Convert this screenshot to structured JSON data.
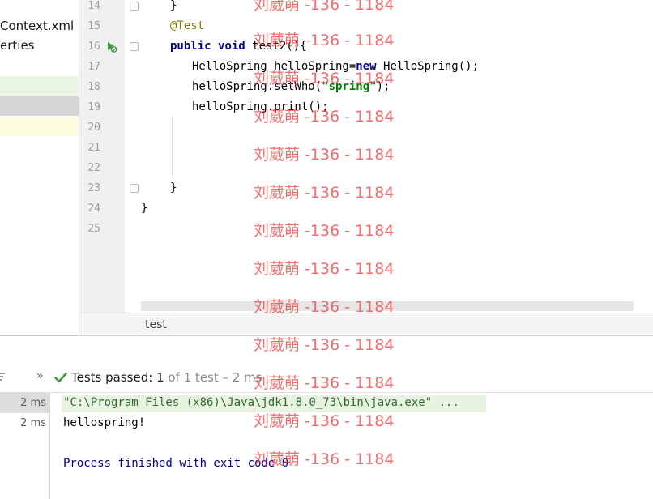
{
  "project_tree": {
    "items": [
      "Context.xml",
      "erties"
    ]
  },
  "editor": {
    "line_numbers": [
      "14",
      "15",
      "16",
      "17",
      "18",
      "19",
      "20",
      "21",
      "22",
      "23",
      "24",
      "25"
    ],
    "code": {
      "l14": "}",
      "l15_annotation": "@Test",
      "l16_kw1": "public",
      "l16_kw2": "void",
      "l16_rest": " test2(){",
      "l17_a": "HelloSpring helloSpring=",
      "l17_kw": "new",
      "l17_b": " HelloSpring();",
      "l18_a": "helloSpring.setWho(",
      "l18_str": "\"spring\"",
      "l18_b": ");",
      "l19": "helloSpring.print();",
      "l23": "}",
      "l24": "}"
    },
    "breadcrumb": "test"
  },
  "run": {
    "chevron": "»",
    "passed_prefix": "Tests passed: ",
    "passed_count": "1",
    "passed_rest": " of 1 test – 2 ms",
    "times": [
      "2 ms",
      "2 ms"
    ],
    "console": {
      "cmd": "\"C:\\Program Files (x86)\\Java\\jdk1.8.0_73\\bin\\java.exe\" ...",
      "output": "hellospring!",
      "exit": "Process finished with exit code 0"
    }
  },
  "watermark": "刘葳萌 -136 - 1184",
  "colors": {
    "keyword": "#000080",
    "annotation": "#808000",
    "string": "#008000",
    "watermark": "#e84646",
    "pass_check": "#3d9b3d"
  }
}
